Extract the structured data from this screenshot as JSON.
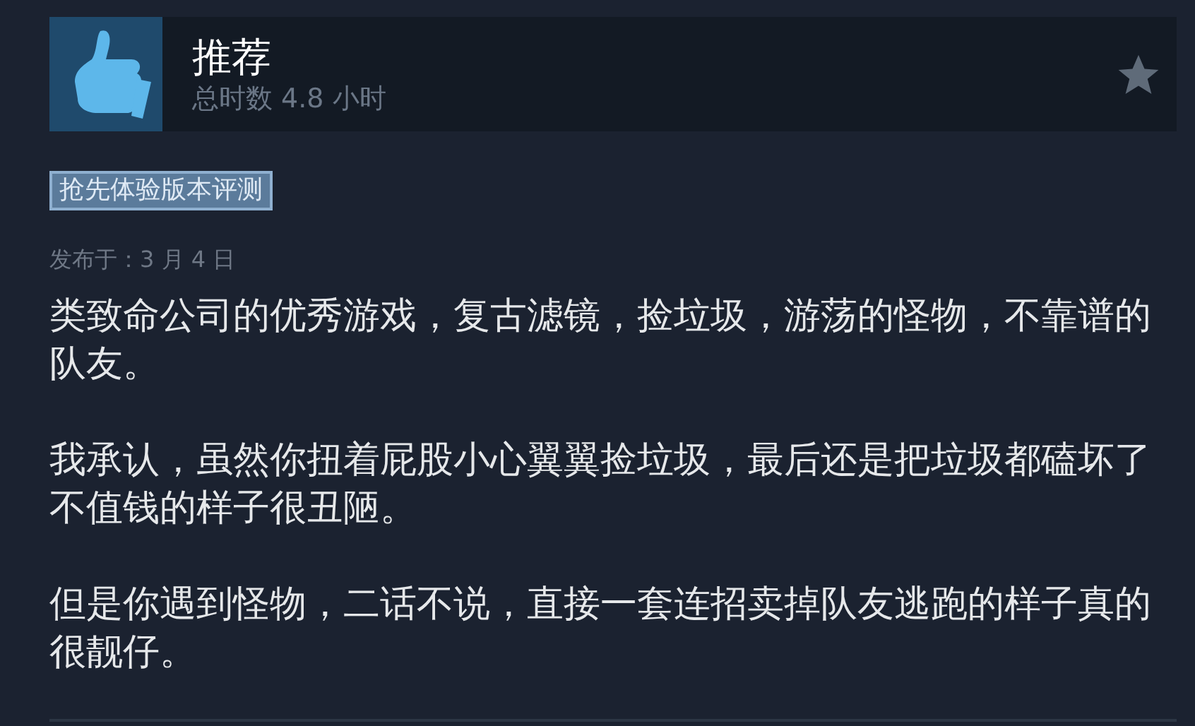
{
  "review": {
    "verdict": "推荐",
    "hours": "总时数 4.8 小时",
    "tag": "抢先体验版本评测",
    "posted": "发布于：3 月 4 日",
    "paragraphs": [
      "类致命公司的优秀游戏，复古滤镜，捡垃圾，游荡的怪物，不靠谱的队友。",
      "我承认，虽然你扭着屁股小心翼翼捡垃圾，最后还是把垃圾都磕坏了不值钱的样子很丑陋。",
      "但是你遇到怪物，二话不说，直接一套连招卖掉队友逃跑的样子真的很靓仔。"
    ]
  }
}
